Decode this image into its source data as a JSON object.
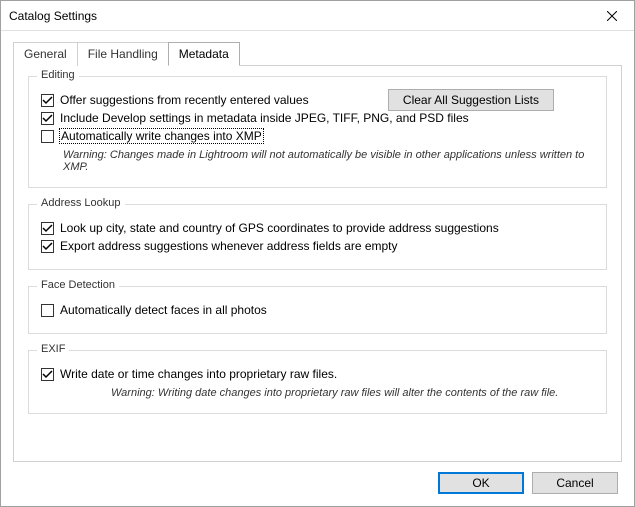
{
  "window": {
    "title": "Catalog Settings"
  },
  "tabs": {
    "general": "General",
    "file_handling": "File Handling",
    "metadata": "Metadata"
  },
  "editing": {
    "legend": "Editing",
    "offer_suggestions": "Offer suggestions from recently entered values",
    "clear_lists_btn": "Clear All Suggestion Lists",
    "include_develop": "Include Develop settings in metadata inside JPEG, TIFF, PNG, and PSD files",
    "auto_write_xmp": "Automatically write changes into XMP",
    "warning": "Warning: Changes made in Lightroom will not automatically be visible in other applications unless written to XMP."
  },
  "address_lookup": {
    "legend": "Address Lookup",
    "lookup_gps": "Look up city, state and country of GPS coordinates to provide address suggestions",
    "export_suggestions": "Export address suggestions whenever address fields are empty"
  },
  "face_detection": {
    "legend": "Face Detection",
    "auto_detect": "Automatically detect faces in all photos"
  },
  "exif": {
    "legend": "EXIF",
    "write_date": "Write date or time changes into proprietary raw files.",
    "warning": "Warning: Writing date changes into proprietary raw files will alter the contents of the raw file."
  },
  "buttons": {
    "ok": "OK",
    "cancel": "Cancel"
  },
  "state": {
    "offer_suggestions": true,
    "include_develop": true,
    "auto_write_xmp": false,
    "lookup_gps": true,
    "export_suggestions": true,
    "auto_detect": false,
    "write_date": true
  }
}
